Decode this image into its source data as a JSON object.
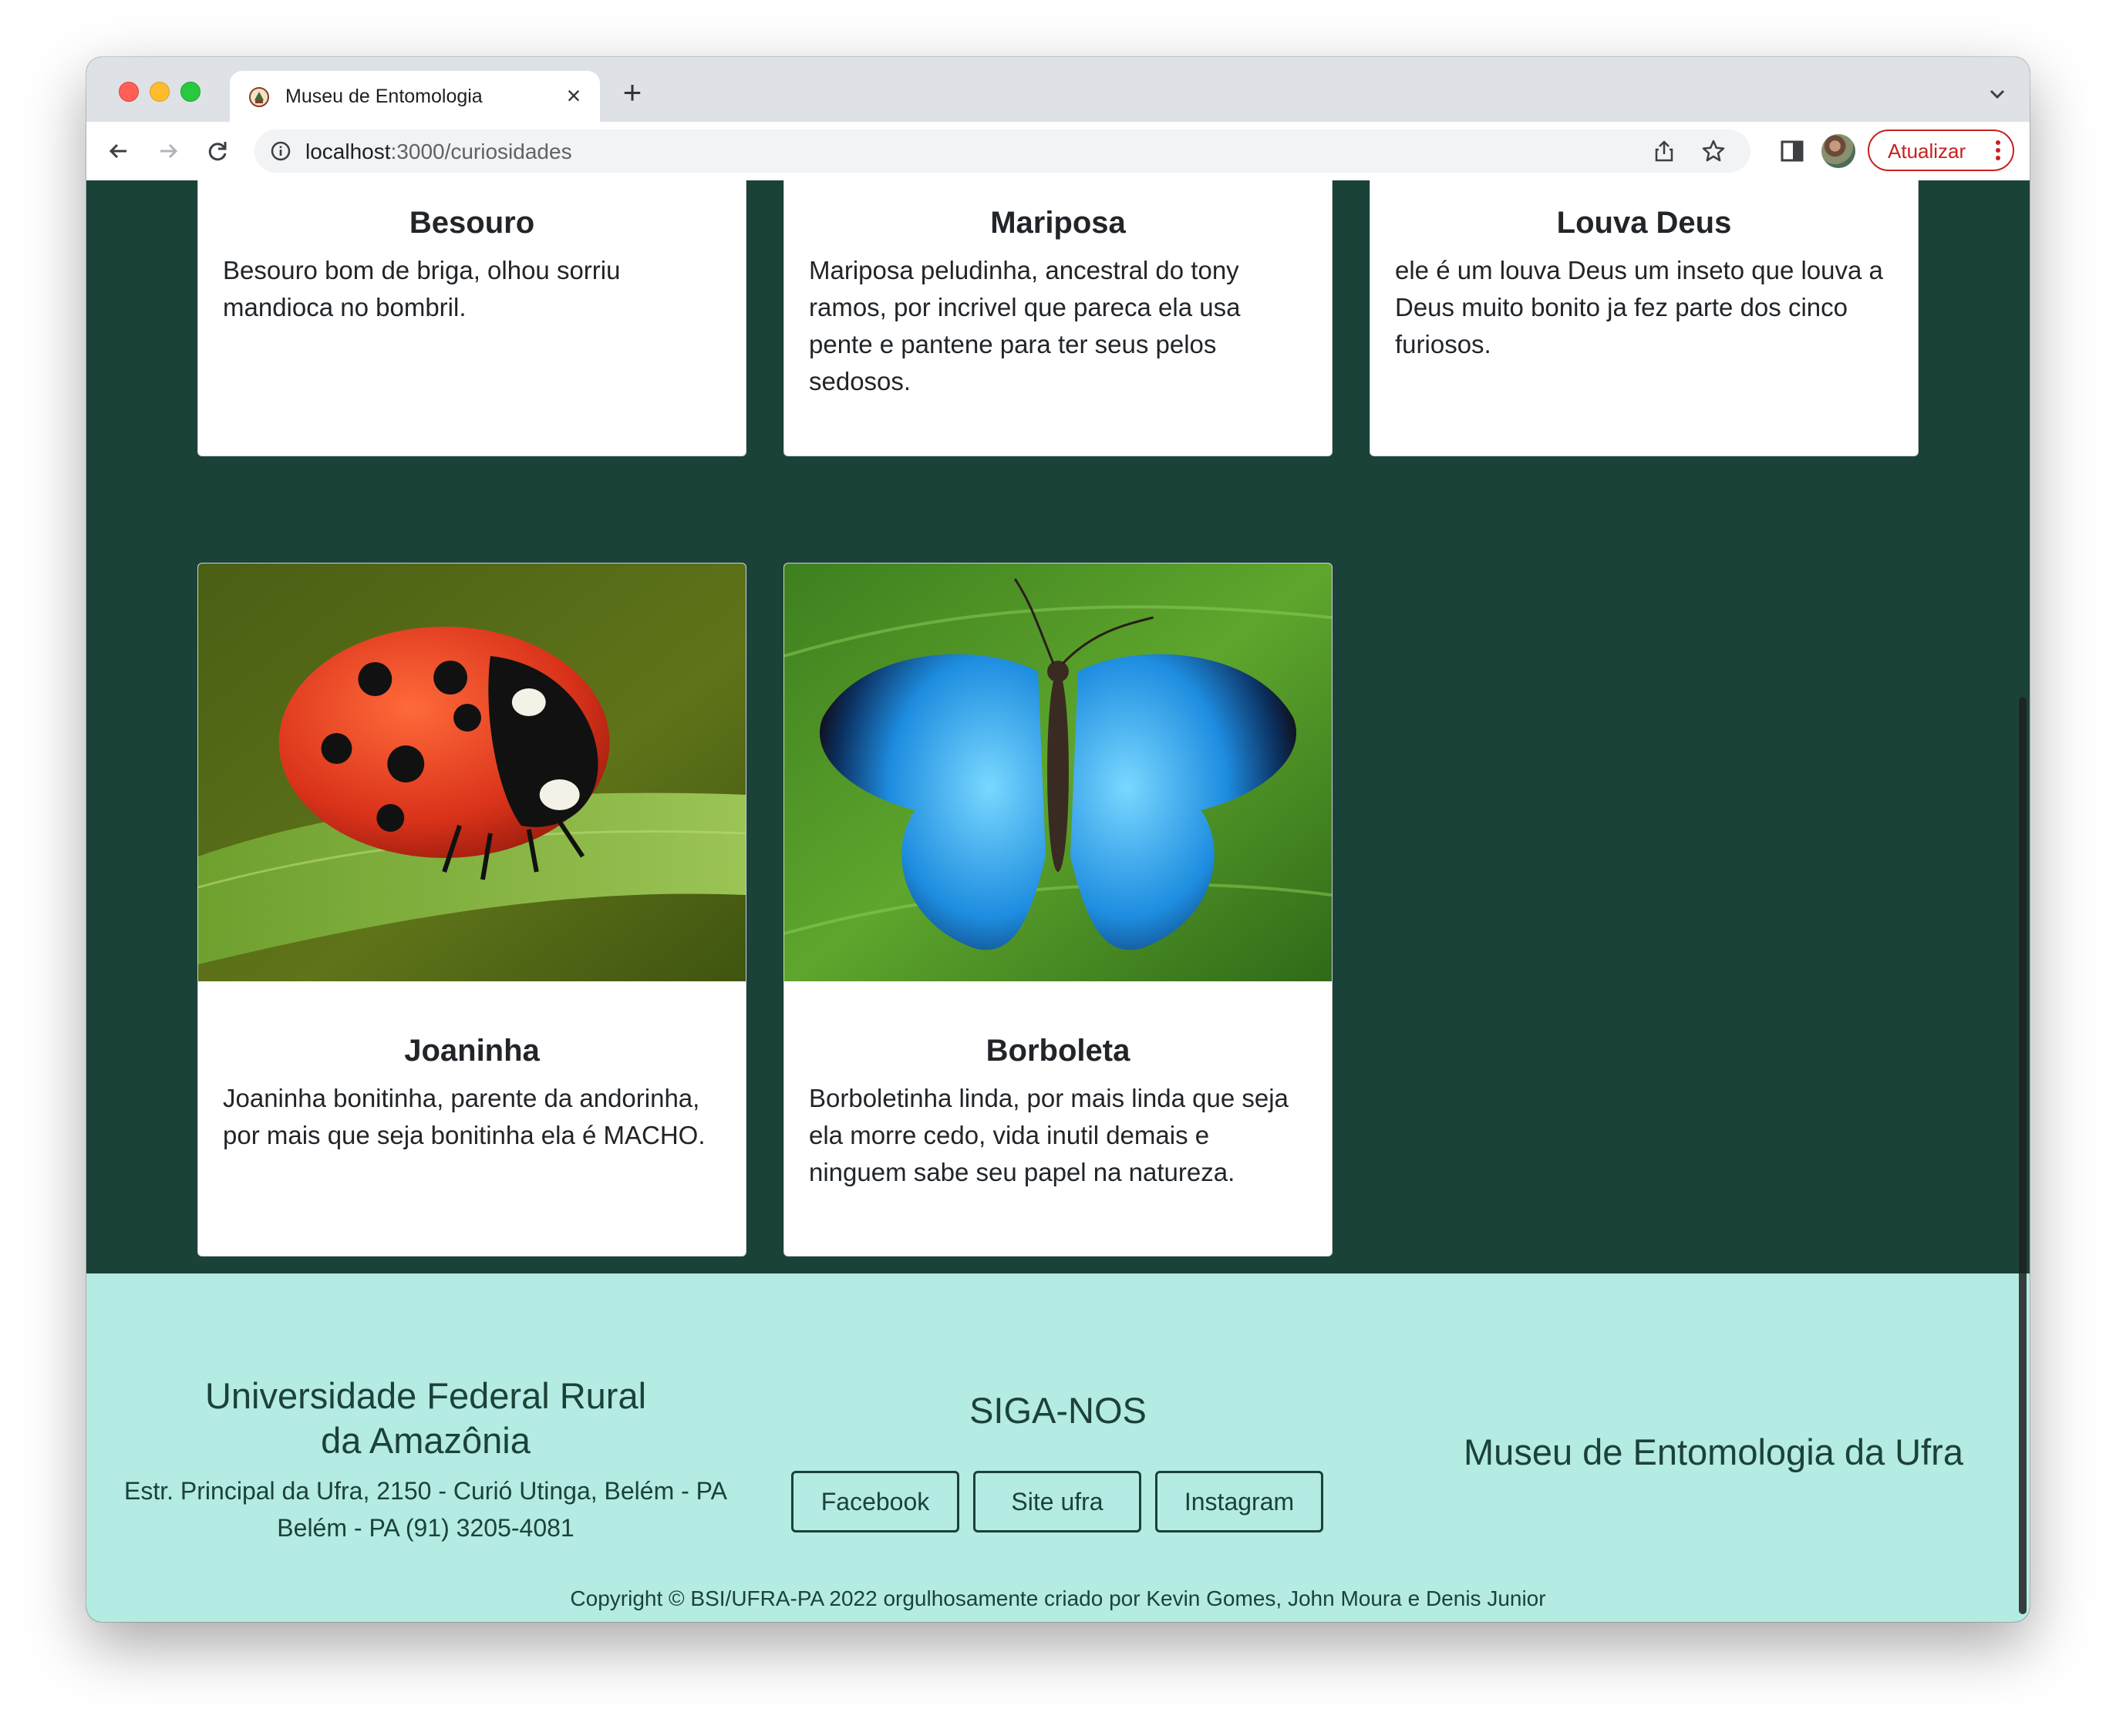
{
  "browser": {
    "tab_title": "Museu de Entomologia",
    "url_host": "localhost",
    "url_path": ":3000/curiosidades",
    "update_label": "Atualizar"
  },
  "cards_top": [
    {
      "title": "Besouro",
      "text": "Besouro bom de briga, olhou sorriu mandioca no bombril."
    },
    {
      "title": "Mariposa",
      "text": "Mariposa peludinha, ancestral do tony ramos, por incrivel que pareca ela usa pente e pantene para ter seus pelos sedosos."
    },
    {
      "title": "Louva Deus",
      "text": "ele é um louva Deus um inseto que louva a Deus muito bonito ja fez parte dos cinco furiosos."
    }
  ],
  "cards_bottom": [
    {
      "title": "Joaninha",
      "text": "Joaninha bonitinha, parente da andorinha, por mais que seja bonitinha ela é MACHO.",
      "image": "ladybug-photo"
    },
    {
      "title": "Borboleta",
      "text": "Borboletinha linda, por mais linda que seja ela morre cedo, vida inutil demais e ninguem sabe seu papel na natureza.",
      "image": "blue-morpho-butterfly-photo"
    }
  ],
  "footer": {
    "university_line1": "Universidade Federal Rural",
    "university_line2": "da Amazônia",
    "address_line1": "Estr. Principal da Ufra, 2150 - Curió Utinga, Belém - PA",
    "address_line2": "Belém - PA (91) 3205-4081",
    "follow_title": "SIGA-NOS",
    "buttons": [
      "Facebook",
      "Site ufra",
      "Instagram"
    ],
    "museum_name": "Museu de Entomologia da Ufra",
    "copyright": "Copyright © BSI/UFRA-PA 2022 orgulhosamente criado por Kevin Gomes, John Moura e Denis Junior"
  },
  "colors": {
    "page_background": "#1b4239",
    "footer_background": "#b4ebe2",
    "footer_text": "#1b4239",
    "update_accent": "#c5221f"
  }
}
